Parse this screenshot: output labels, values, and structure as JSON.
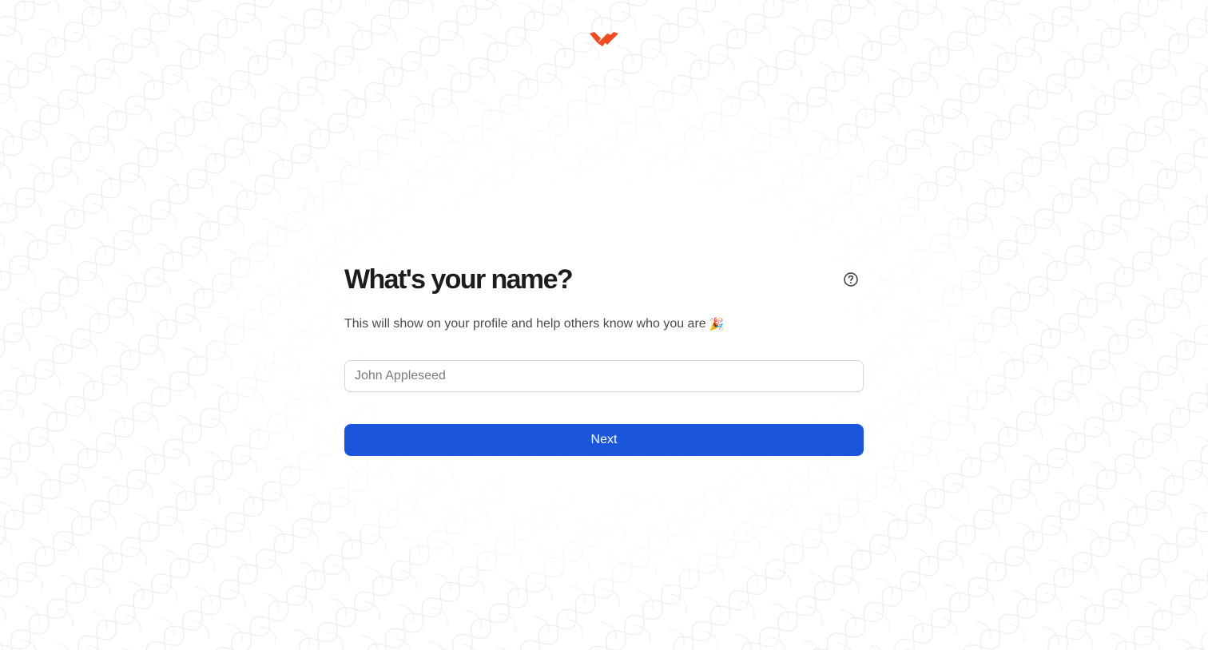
{
  "brand": {
    "logo_icon": "brand-logo-icon",
    "accent_color": "#f04b23"
  },
  "form": {
    "title": "What's your name?",
    "subtitle": "This will show on your profile and help others know who you are",
    "subtitle_emoji": "🎉",
    "help_icon": "question-circle-icon",
    "name_input": {
      "value": "",
      "placeholder": "John Appleseed"
    },
    "next_label": "Next",
    "button_color": "#1a56db"
  }
}
